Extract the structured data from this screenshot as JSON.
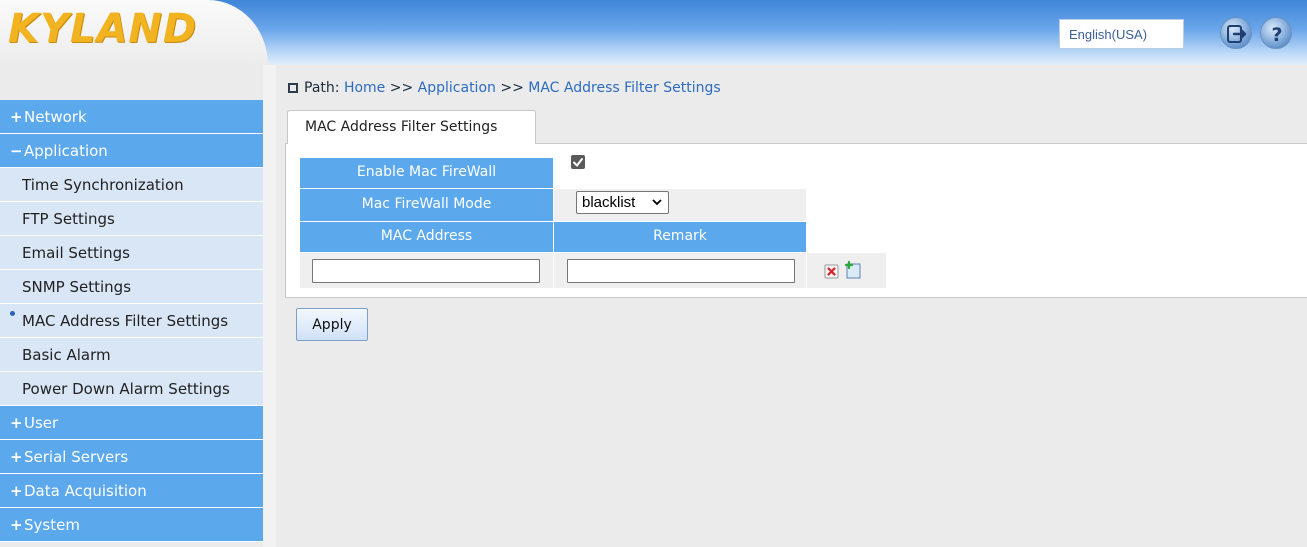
{
  "header": {
    "logo_text": "KYLAND",
    "language": "English(USA)",
    "icons": [
      "logout-icon",
      "help-icon"
    ]
  },
  "sidebar": {
    "items": [
      {
        "type": "group",
        "symbol": "+",
        "label": "Network"
      },
      {
        "type": "group",
        "symbol": "−",
        "label": "Application"
      },
      {
        "type": "sub",
        "label": "Time Synchronization"
      },
      {
        "type": "sub",
        "label": "FTP Settings"
      },
      {
        "type": "sub",
        "label": "Email Settings"
      },
      {
        "type": "sub",
        "label": "SNMP Settings"
      },
      {
        "type": "sub",
        "label": "MAC Address Filter Settings",
        "active": true
      },
      {
        "type": "sub",
        "label": "Basic Alarm"
      },
      {
        "type": "sub",
        "label": "Power Down Alarm Settings"
      },
      {
        "type": "group",
        "symbol": "+",
        "label": "User"
      },
      {
        "type": "group",
        "symbol": "+",
        "label": "Serial Servers"
      },
      {
        "type": "group",
        "symbol": "+",
        "label": "Data Acquisition"
      },
      {
        "type": "group",
        "symbol": "+",
        "label": "System"
      }
    ]
  },
  "breadcrumb": {
    "prefix": "Path:",
    "home": "Home",
    "sep": ">>",
    "section": "Application",
    "page": "MAC Address Filter Settings"
  },
  "tab": {
    "label": "MAC Address Filter Settings"
  },
  "form": {
    "enable_label": "Enable Mac FireWall",
    "enable_checked": true,
    "mode_label": "Mac FireWall Mode",
    "mode_value": "blacklist",
    "col_mac": "MAC Address",
    "col_remark": "Remark",
    "mac_value": "",
    "remark_value": "",
    "row_icons": [
      "delete-row-icon",
      "add-row-icon"
    ]
  },
  "apply_label": "Apply",
  "colors": {
    "accent": "#5ba8ec",
    "sub_bg": "#d9e6f6",
    "link": "#2d6cbf",
    "logo": "#f2b320"
  }
}
